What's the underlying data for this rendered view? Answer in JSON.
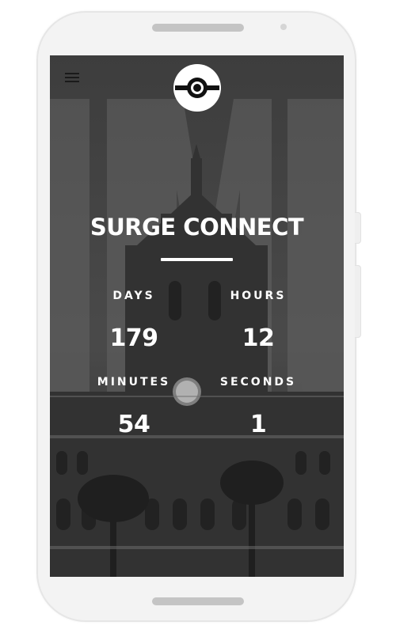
{
  "app": {
    "title": "SURGE CONNECT",
    "menu_icon": "hamburger-menu-icon",
    "logo_icon": "eye-logo-icon"
  },
  "countdown": {
    "days": {
      "label": "DAYS",
      "value": "179"
    },
    "hours": {
      "label": "HOURS",
      "value": "12"
    },
    "minutes": {
      "label": "MINUTES",
      "value": "54"
    },
    "seconds": {
      "label": "SECONDS",
      "value": "1"
    }
  },
  "colors": {
    "text": "#ffffff",
    "screen_bg": "#5d5d5d",
    "phone_body": "#f3f3f3"
  }
}
